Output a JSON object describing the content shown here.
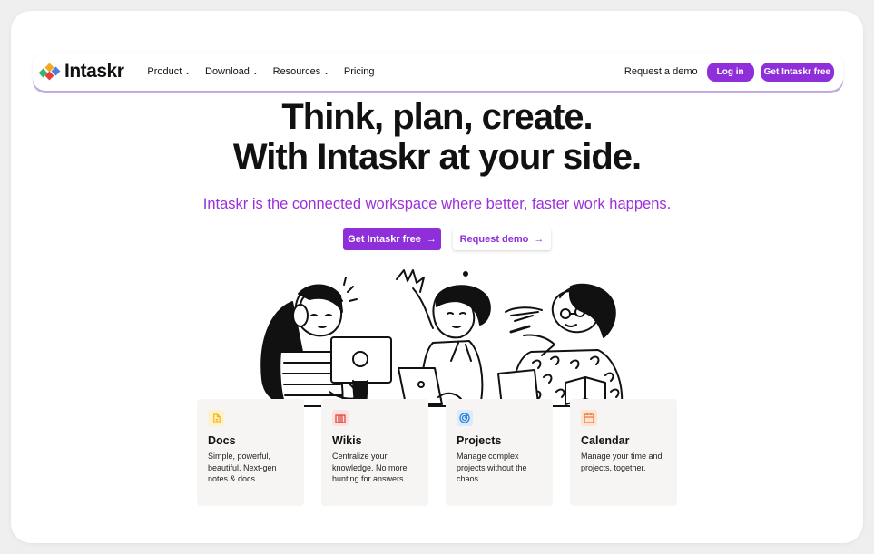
{
  "brand": {
    "name": "Intaskr"
  },
  "nav": {
    "links": [
      {
        "label": "Product",
        "dropdown": true
      },
      {
        "label": "Download",
        "dropdown": true
      },
      {
        "label": "Resources",
        "dropdown": true
      },
      {
        "label": "Pricing",
        "dropdown": false
      }
    ],
    "request_demo": "Request a demo",
    "login": "Log in",
    "get_free": "Get Intaskr free"
  },
  "hero": {
    "title_line1": "Think, plan, create.",
    "title_line2": "With Intaskr at your side.",
    "subtitle": "Intaskr is the connected workspace where better, faster work happens.",
    "cta_primary": "Get Intaskr free",
    "cta_secondary": "Request demo"
  },
  "features": [
    {
      "icon": "doc-icon",
      "title": "Docs",
      "desc": "Simple, powerful, beautiful. Next-gen notes & docs.",
      "color": "#f5b400",
      "bg": "#fdf2cf"
    },
    {
      "icon": "book-icon",
      "title": "Wikis",
      "desc": "Centralize your knowledge. No more hunting for answers.",
      "color": "#e4483e",
      "bg": "#fbe1df"
    },
    {
      "icon": "target-icon",
      "title": "Projects",
      "desc": "Manage complex projects without the chaos.",
      "color": "#2b7fd9",
      "bg": "#dcebfb"
    },
    {
      "icon": "calendar-icon",
      "title": "Calendar",
      "desc": "Manage your time and projects, together.",
      "color": "#ef7a3a",
      "bg": "#fde3d3"
    }
  ],
  "colors": {
    "accent": "#8e2fd9",
    "subtitle": "#9b30d9"
  }
}
